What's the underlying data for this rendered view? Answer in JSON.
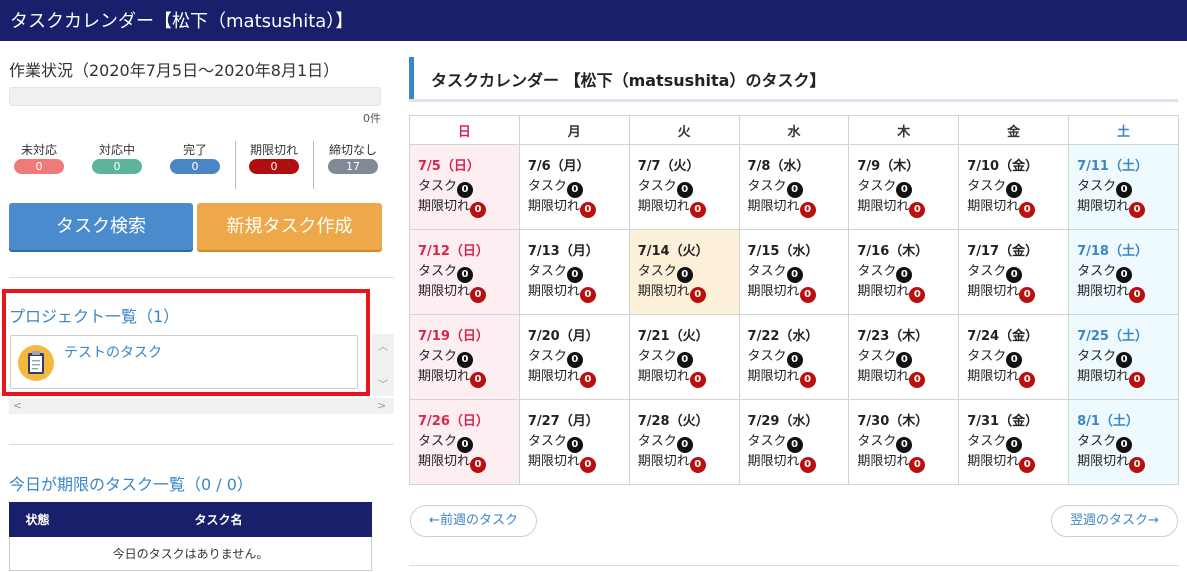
{
  "header": {
    "title": "タスクカレンダー【松下（matsushita）】"
  },
  "status": {
    "title": "作業状況（2020年7月5日～2020年8月1日）",
    "count_label": "0件",
    "stats": [
      {
        "label": "未対応",
        "value": "0",
        "color": "#ee7b79"
      },
      {
        "label": "対応中",
        "value": "0",
        "color": "#5cb49a"
      },
      {
        "label": "完了",
        "value": "0",
        "color": "#4a86c6"
      },
      {
        "label": "期限切れ",
        "value": "0",
        "color": "#b00f0f"
      },
      {
        "label": "締切なし",
        "value": "17",
        "color": "#7f8a96"
      }
    ]
  },
  "buttons": {
    "search": "タスク検索",
    "new": "新規タスク作成"
  },
  "projects": {
    "title": "プロジェクト一覧（1）",
    "items": [
      {
        "name": "テストのタスク"
      }
    ]
  },
  "today": {
    "title": "今日が期限のタスク一覧（0 / 0）",
    "col_status": "状態",
    "col_name": "タスク名",
    "empty": "今日のタスクはありません。"
  },
  "calendar": {
    "title": "タスクカレンダー 【松下（matsushita）のタスク】",
    "weekdays": [
      "日",
      "月",
      "火",
      "水",
      "木",
      "金",
      "土"
    ],
    "task_label": "タスク",
    "overdue_label": "期限切れ",
    "weeks": [
      [
        {
          "date": "7/5（日）",
          "tasks": "0",
          "overdue": "0"
        },
        {
          "date": "7/6（月）",
          "tasks": "0",
          "overdue": "0"
        },
        {
          "date": "7/7（火）",
          "tasks": "0",
          "overdue": "0"
        },
        {
          "date": "7/8（水）",
          "tasks": "0",
          "overdue": "0"
        },
        {
          "date": "7/9（木）",
          "tasks": "0",
          "overdue": "0"
        },
        {
          "date": "7/10（金）",
          "tasks": "0",
          "overdue": "0"
        },
        {
          "date": "7/11（土）",
          "tasks": "0",
          "overdue": "0"
        }
      ],
      [
        {
          "date": "7/12（日）",
          "tasks": "0",
          "overdue": "0"
        },
        {
          "date": "7/13（月）",
          "tasks": "0",
          "overdue": "0"
        },
        {
          "date": "7/14（火）",
          "tasks": "0",
          "overdue": "0",
          "today": true
        },
        {
          "date": "7/15（水）",
          "tasks": "0",
          "overdue": "0"
        },
        {
          "date": "7/16（木）",
          "tasks": "0",
          "overdue": "0"
        },
        {
          "date": "7/17（金）",
          "tasks": "0",
          "overdue": "0"
        },
        {
          "date": "7/18（土）",
          "tasks": "0",
          "overdue": "0"
        }
      ],
      [
        {
          "date": "7/19（日）",
          "tasks": "0",
          "overdue": "0"
        },
        {
          "date": "7/20（月）",
          "tasks": "0",
          "overdue": "0"
        },
        {
          "date": "7/21（火）",
          "tasks": "0",
          "overdue": "0"
        },
        {
          "date": "7/22（水）",
          "tasks": "0",
          "overdue": "0"
        },
        {
          "date": "7/23（木）",
          "tasks": "0",
          "overdue": "0"
        },
        {
          "date": "7/24（金）",
          "tasks": "0",
          "overdue": "0"
        },
        {
          "date": "7/25（土）",
          "tasks": "0",
          "overdue": "0"
        }
      ],
      [
        {
          "date": "7/26（日）",
          "tasks": "0",
          "overdue": "0"
        },
        {
          "date": "7/27（月）",
          "tasks": "0",
          "overdue": "0"
        },
        {
          "date": "7/28（火）",
          "tasks": "0",
          "overdue": "0"
        },
        {
          "date": "7/29（水）",
          "tasks": "0",
          "overdue": "0"
        },
        {
          "date": "7/30（木）",
          "tasks": "0",
          "overdue": "0"
        },
        {
          "date": "7/31（金）",
          "tasks": "0",
          "overdue": "0"
        },
        {
          "date": "8/1（土）",
          "tasks": "0",
          "overdue": "0"
        }
      ]
    ],
    "prev_label": "←前週のタスク",
    "next_label": "翌週のタスク→"
  }
}
